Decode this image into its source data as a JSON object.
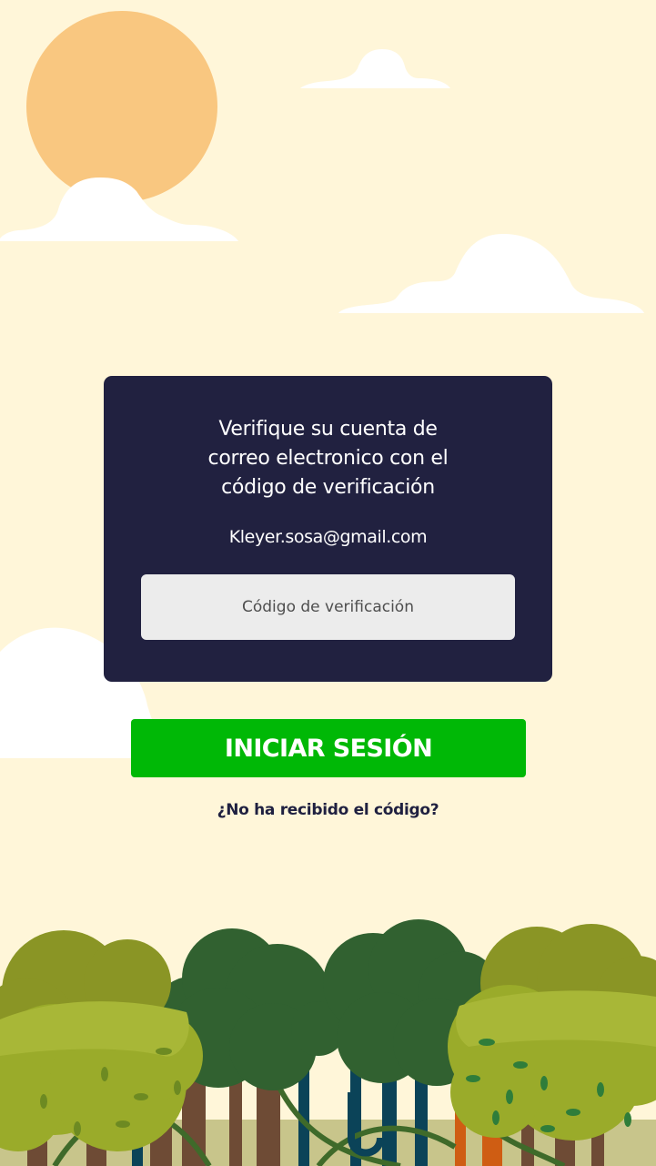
{
  "verify": {
    "title_line1": "Verifique su cuenta de",
    "title_line2": "correo electronico con el",
    "title_line3": "código de verificación",
    "email": "Kleyer.sosa@gmail.com"
  },
  "code_input": {
    "value": "",
    "placeholder": "Código de verificación"
  },
  "login_button": {
    "label": "INICIAR SESIÓN"
  },
  "resend_link": {
    "label": "¿No ha recibido el código?"
  },
  "colors": {
    "background": "#fff6d9",
    "card": "#212140",
    "button": "#00b806",
    "sun": "#f9c780",
    "cloud": "#ffffff",
    "tree_dark": "#316130",
    "tree_light": "#9aab2a",
    "tree_mid": "#8a9525"
  }
}
